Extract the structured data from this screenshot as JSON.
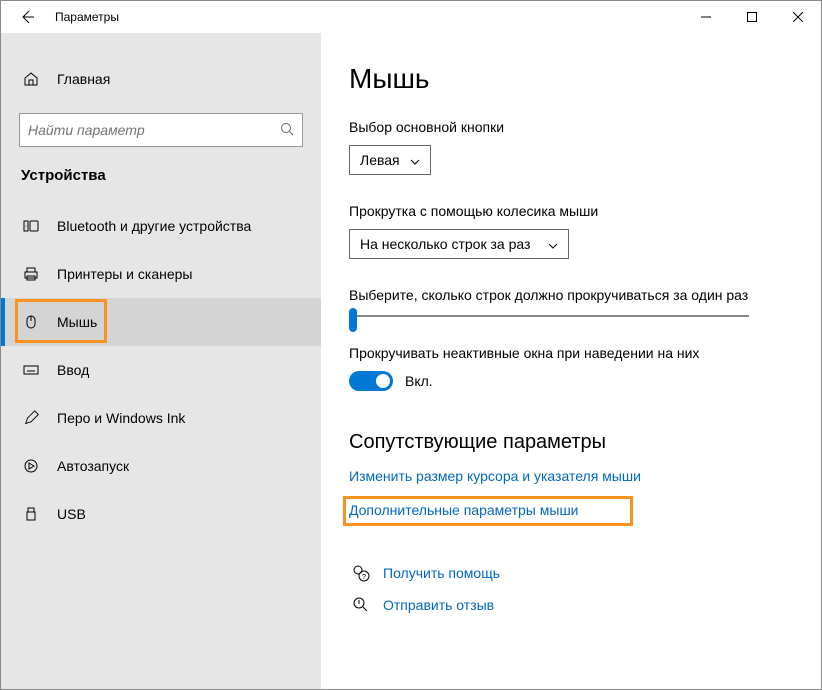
{
  "window": {
    "title": "Параметры"
  },
  "sidebar": {
    "home": "Главная",
    "search_placeholder": "Найти параметр",
    "section": "Устройства",
    "items": [
      {
        "label": "Bluetooth и другие устройства"
      },
      {
        "label": "Принтеры и сканеры"
      },
      {
        "label": "Мышь"
      },
      {
        "label": "Ввод"
      },
      {
        "label": "Перо и Windows Ink"
      },
      {
        "label": "Автозапуск"
      },
      {
        "label": "USB"
      }
    ]
  },
  "content": {
    "title": "Мышь",
    "primary_button_label": "Выбор основной кнопки",
    "primary_button_value": "Левая",
    "scroll_label": "Прокрутка с помощью колесика мыши",
    "scroll_value": "На несколько строк за раз",
    "lines_label": "Выберите, сколько строк должно прокручиваться за один раз",
    "inactive_label": "Прокручивать неактивные окна при наведении на них",
    "toggle_state": "Вкл.",
    "related_header": "Сопутствующие параметры",
    "link_cursor": "Изменить размер курсора и указателя мыши",
    "link_advanced": "Дополнительные параметры мыши",
    "help_link": "Получить помощь",
    "feedback_link": "Отправить отзыв"
  }
}
